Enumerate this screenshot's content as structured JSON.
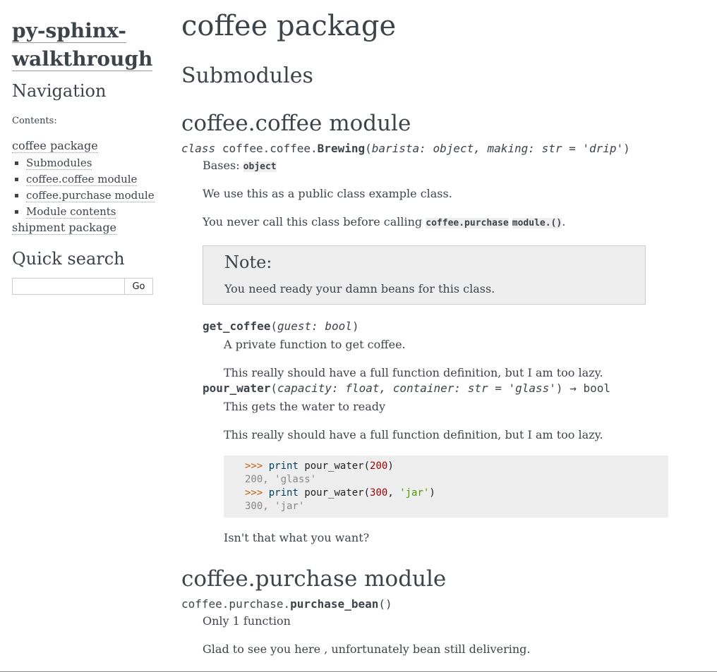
{
  "sidebar": {
    "logo_line1": "py-sphinx-",
    "logo_line2": "walkthrough",
    "navigation_title": "Navigation",
    "contents_label": "Contents:",
    "toc_top": "coffee package",
    "toc_items": [
      "Submodules",
      "coffee.coffee module",
      "coffee.purchase module",
      "Module contents"
    ],
    "toc_next": "shipment package",
    "quick_search_title": "Quick search",
    "search_value": "",
    "go_label": "Go"
  },
  "main": {
    "title": "coffee package",
    "submodules_heading": "Submodules",
    "coffee_module_heading": "coffee.coffee module",
    "brewing_sig": {
      "keyword": "class",
      "prefix": "coffee.coffee.",
      "name": "Brewing",
      "open": "(",
      "params": "barista: object, making: str = 'drip'",
      "close": ")"
    },
    "bases_label": "Bases:",
    "bases_value": "object",
    "para1": "We use this as a public class example class.",
    "para2_pre": "You never call this class before calling",
    "para2_code1": "coffee.purchase",
    "para2_code2": "module.()",
    "para2_post": ".",
    "note_title": "Note:",
    "note_body": "You need ready your damn beans for this class.",
    "get_coffee": {
      "name": "get_coffee",
      "open": "(",
      "params": "guest: bool",
      "close": ")",
      "desc1": "A private function to get coffee.",
      "desc2": "This really should have a full function definition, but I am too lazy."
    },
    "pour_water": {
      "name": "pour_water",
      "open": "(",
      "params": "capacity: float, container: str = 'glass'",
      "close": ")",
      "ret": "→ bool",
      "desc1": "This gets the water to ready",
      "desc2": "This really should have a full function definition, but I am too lazy."
    },
    "code_example": {
      "prompt": ">>>",
      "print_kw": "print",
      "call1_pre": "pour_water(",
      "call1_num": "200",
      "call1_post": ")",
      "out1": "200, 'glass'",
      "call2_pre": "pour_water(",
      "call2_num": "300",
      "call2_sep": ", ",
      "call2_str": "'jar'",
      "call2_post": ")",
      "out2": "300, 'jar'"
    },
    "after_code": "Isn't that what you want?",
    "purchase_module_heading": "coffee.purchase module",
    "purchase_sig": {
      "prefix": "coffee.purchase.",
      "name": "purchase_bean",
      "parens": "()"
    },
    "purchase_desc1": "Only 1 function",
    "purchase_desc2": "Glad to see you here , unfortunately bean still delivering."
  }
}
